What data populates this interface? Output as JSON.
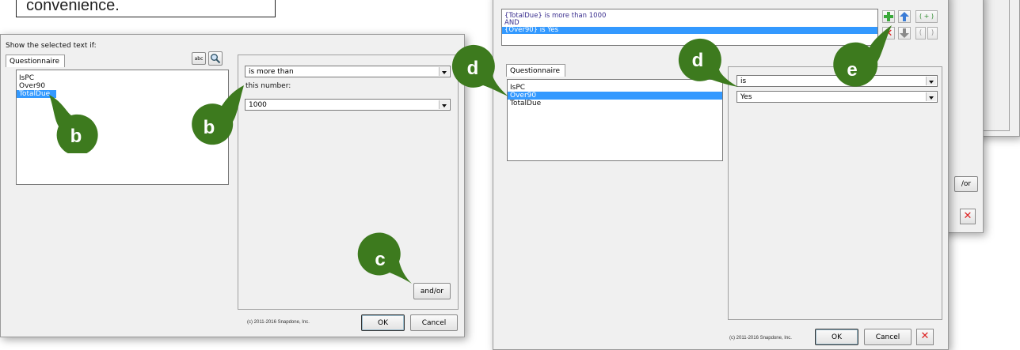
{
  "callout": {
    "text": "convenience."
  },
  "left_dialog": {
    "title": "Show the selected text if:",
    "tab_label": "Questionnaire",
    "abc_icon_label": "abc",
    "fields": [
      "IsPC",
      "Over90",
      "TotalDue"
    ],
    "selected_field": "TotalDue",
    "operator": "is more than",
    "value_label": "this number:",
    "value": "1000",
    "andor_button": "and/or",
    "copyright": "(c) 2011-2016 Snapdone, Inc.",
    "ok_button": "OK",
    "cancel_button": "Cancel"
  },
  "right_dialog": {
    "conditions": [
      "{TotalDue} is more than 1000",
      "AND",
      "{Over90} is Yes"
    ],
    "selected_condition": "{Over90} is Yes",
    "tab_label": "Questionnaire",
    "fields": [
      "IsPC",
      "Over90",
      "TotalDue"
    ],
    "selected_field": "Over90",
    "operator": "is",
    "value": "Yes",
    "toolbar": {
      "add_paren": "( + )",
      "open_paren": "(",
      "close_paren": ")"
    },
    "copyright": "(c) 2011-2016 Snapdone, Inc.",
    "ok_button": "OK",
    "cancel_button": "Cancel",
    "close_glyph": "✕"
  },
  "back_dialog": {
    "andor_partial": "/or",
    "close_glyph": "✕"
  },
  "markers": [
    "b",
    "b",
    "c",
    "d",
    "d",
    "e"
  ],
  "colors": {
    "marker": "#3d7a1e",
    "selection": "#3399ff",
    "condition_text": "#3b2f8f"
  }
}
